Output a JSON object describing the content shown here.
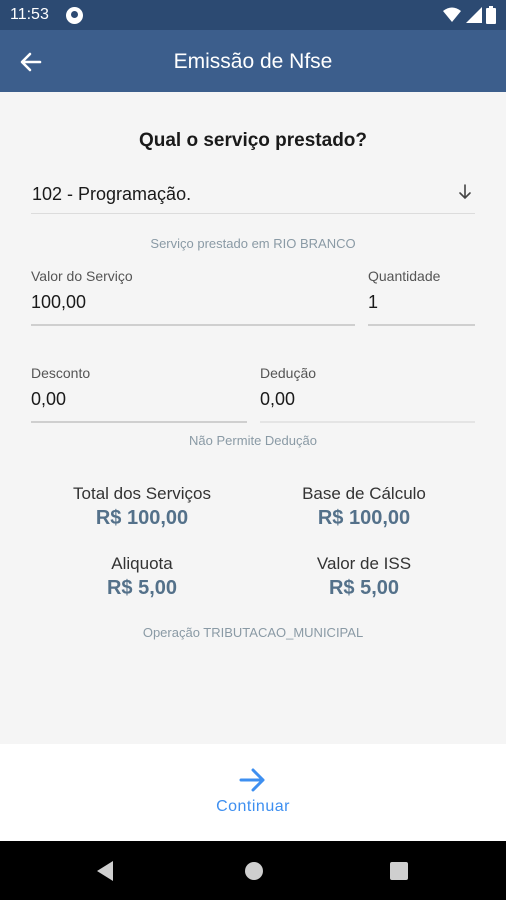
{
  "status_bar": {
    "time": "11:53"
  },
  "app_bar": {
    "title": "Emissão de Nfse"
  },
  "form": {
    "question": "Qual o serviço prestado?",
    "service": "102  - Programação.",
    "service_location": "Serviço prestado em RIO BRANCO",
    "valor_label": "Valor do Serviço",
    "valor_value": "100,00",
    "quantidade_label": "Quantidade",
    "quantidade_value": "1",
    "desconto_label": "Desconto",
    "desconto_value": "0,00",
    "deducao_label": "Dedução",
    "deducao_value": "0,00",
    "deducao_note": "Não Permite Dedução"
  },
  "summary": {
    "total_label": "Total dos Serviços",
    "total_value": "R$ 100,00",
    "base_label": "Base de Cálculo",
    "base_value": "R$ 100,00",
    "aliquota_label": "Aliquota",
    "aliquota_value": "R$ 5,00",
    "iss_label": "Valor de ISS",
    "iss_value": "R$ 5,00",
    "operacao": "Operação TRIBUTACAO_MUNICIPAL"
  },
  "actions": {
    "continue_label": "Continuar"
  },
  "colors": {
    "status_bar": "#2c4a72",
    "app_bar": "#3c5e8c",
    "accent": "#3e8ff0",
    "value_text": "#54718a"
  },
  "icons": {
    "back": "arrow-left-icon",
    "dropdown": "arrow-down-icon",
    "continue": "arrow-right-icon"
  }
}
